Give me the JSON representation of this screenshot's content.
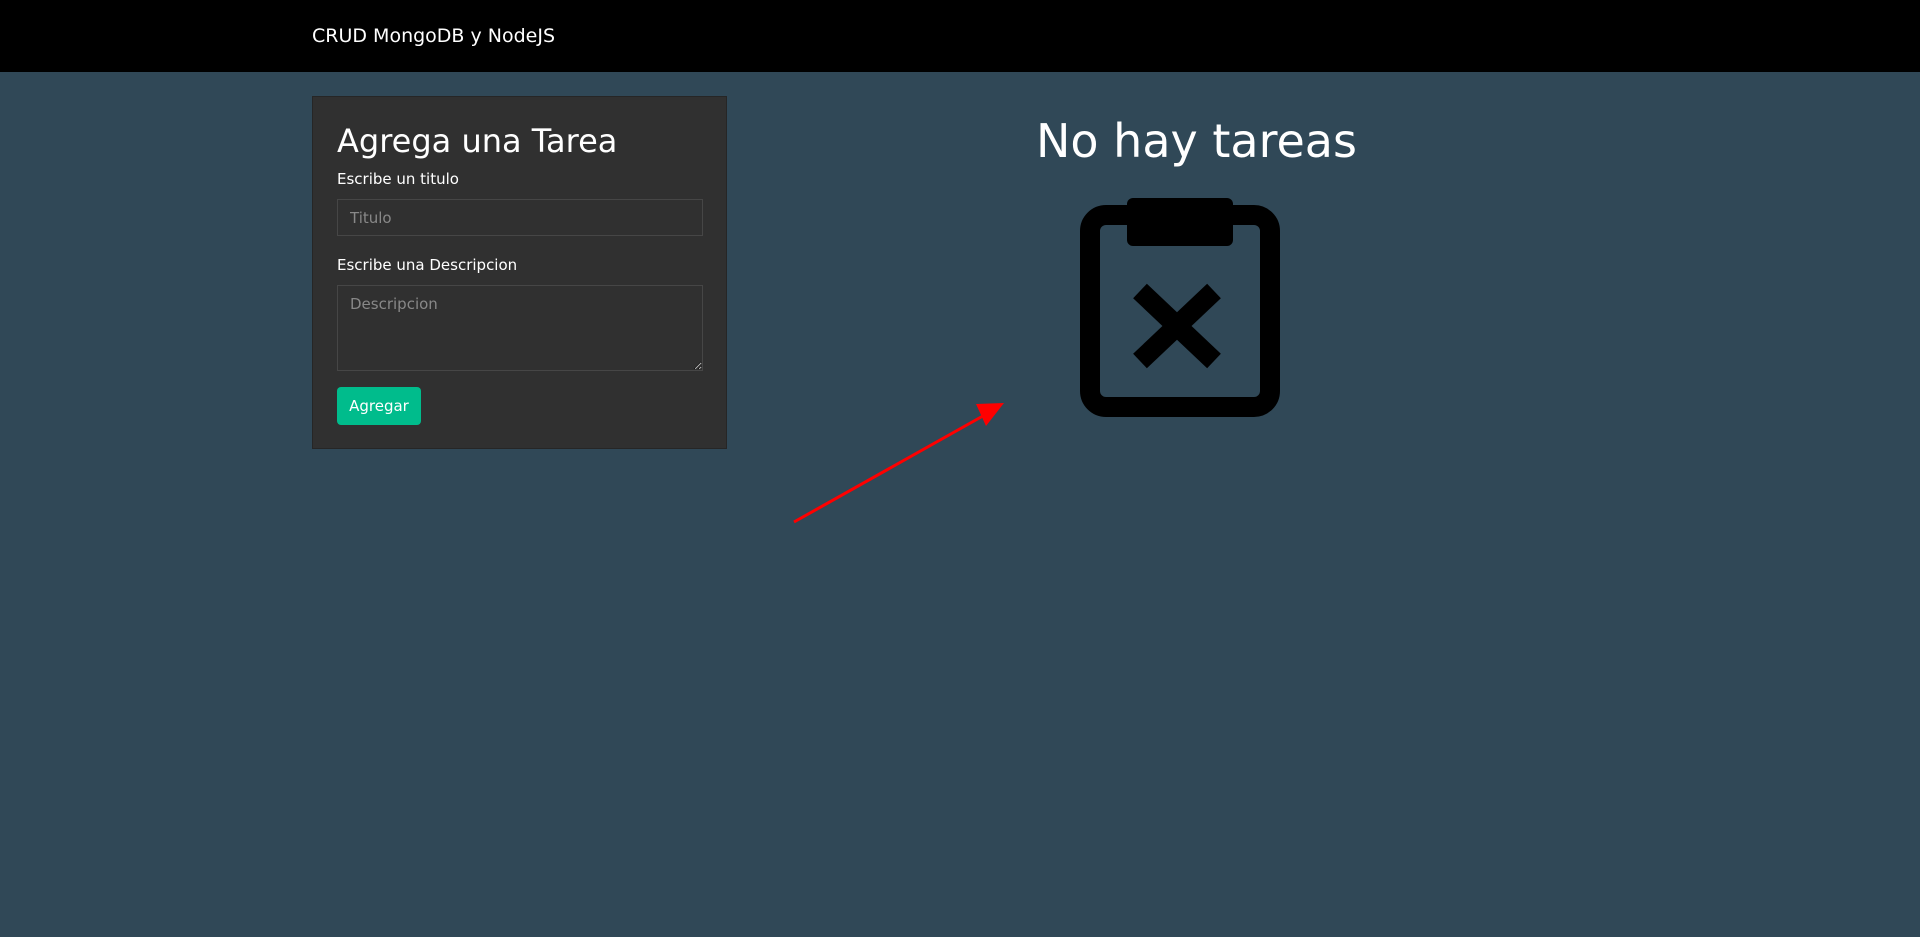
{
  "navbar": {
    "brand": "CRUD MongoDB y NodeJS"
  },
  "form": {
    "title": "Agrega una Tarea",
    "title_label": "Escribe un titulo",
    "title_placeholder": "Titulo",
    "title_value": "",
    "description_label": "Escribe una Descripcion",
    "description_placeholder": "Descripcion",
    "description_value": "",
    "submit_label": "Agregar"
  },
  "empty_state": {
    "message": "No hay tareas",
    "icon": "clipboard-x-icon"
  },
  "annotation": {
    "icon": "arrow-annotation-icon"
  },
  "colors": {
    "background": "#304857",
    "navbar": "#000000",
    "card": "#303030",
    "accent": "#00bc8c",
    "arrow": "#ff0000"
  }
}
